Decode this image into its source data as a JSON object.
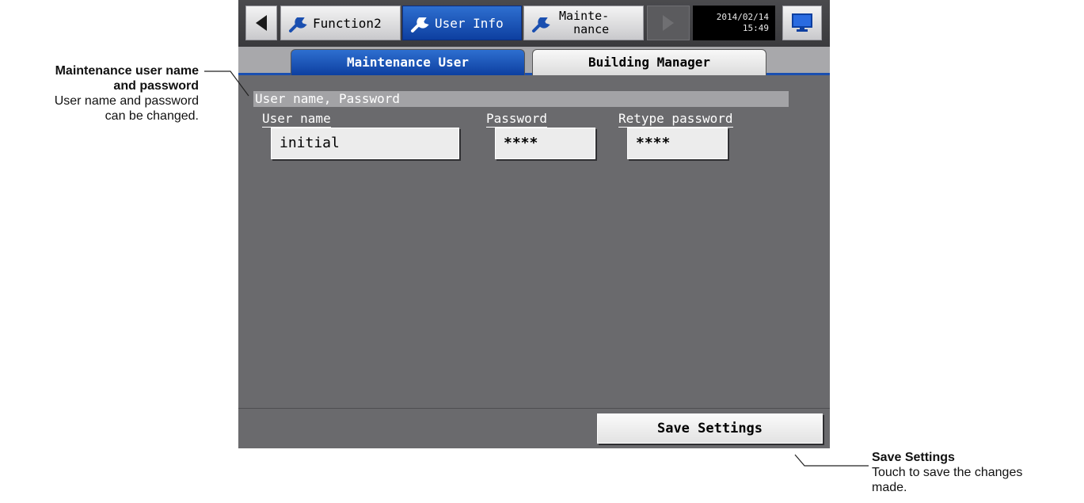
{
  "callouts": {
    "left": {
      "title_line1": "Maintenance user name",
      "title_line2": "and password",
      "desc_line1": "User name and password",
      "desc_line2": "can be changed."
    },
    "right": {
      "title": "Save Settings",
      "desc_line1": "Touch to save the changes",
      "desc_line2": "made."
    }
  },
  "topbar": {
    "tabs": [
      {
        "label": "Function2",
        "icon": "wrench-icon",
        "active": false
      },
      {
        "label": "User Info",
        "icon": "wrench-icon",
        "active": true
      },
      {
        "label_line1": "Mainte-",
        "label_line2": "nance",
        "icon": "wrench-icon",
        "active": false
      }
    ],
    "date": "2014/02/14",
    "time": "15:49"
  },
  "subtabs": [
    {
      "label": "Maintenance User",
      "active": true
    },
    {
      "label": "Building Manager",
      "active": false
    }
  ],
  "form": {
    "section_title": "User name, Password",
    "username_label": "User name",
    "username_value": "initial",
    "password_label": "Password",
    "password_value": "****",
    "retype_label": "Retype password",
    "retype_value": "****"
  },
  "footer": {
    "save_label": "Save Settings"
  },
  "colors": {
    "active_tab": "#1a4fb0",
    "screen_bg": "#6a6a6d"
  }
}
